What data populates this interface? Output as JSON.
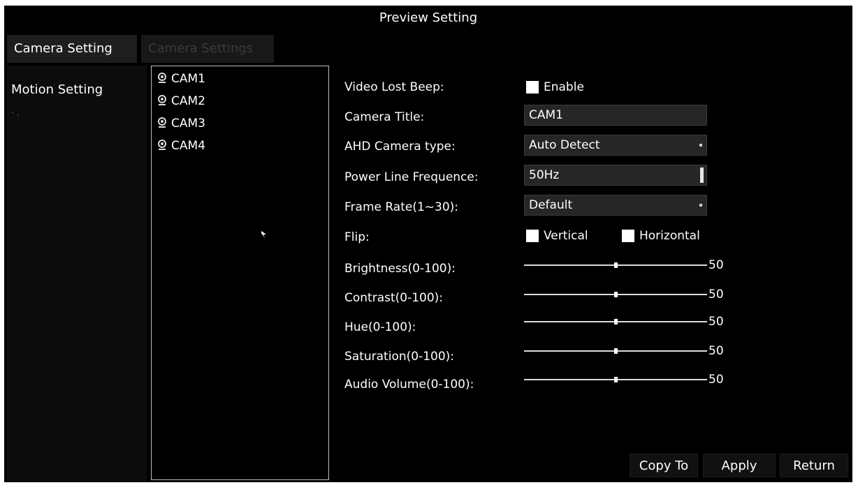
{
  "window": {
    "title": "Preview Setting"
  },
  "tabs": [
    {
      "label": "Camera Setting",
      "active": true
    },
    {
      "label": "Camera Settings",
      "active": false
    }
  ],
  "sidebar": {
    "items": [
      {
        "label": "Motion Setting"
      }
    ]
  },
  "camera_list": {
    "items": [
      {
        "label": "CAM1",
        "icon": "camera-icon"
      },
      {
        "label": "CAM2",
        "icon": "camera-icon"
      },
      {
        "label": "CAM3",
        "icon": "camera-icon"
      },
      {
        "label": "CAM4",
        "icon": "camera-icon"
      }
    ]
  },
  "form": {
    "video_lost_beep": {
      "label": "Video Lost Beep:",
      "option": "Enable",
      "checked": false
    },
    "camera_title": {
      "label": "Camera Title:",
      "value": "CAM1"
    },
    "ahd_camera_type": {
      "label": "AHD Camera type:",
      "value": "Auto Detect"
    },
    "power_line_frequence": {
      "label": "Power Line Frequence:",
      "value": "50Hz"
    },
    "frame_rate": {
      "label": "Frame Rate(1~30):",
      "value": "Default"
    },
    "flip": {
      "label": "Flip:",
      "vertical": {
        "label": "Vertical",
        "checked": false
      },
      "horizontal": {
        "label": "Horizontal",
        "checked": false
      }
    },
    "sliders": [
      {
        "label": "Brightness(0-100):",
        "value": "50",
        "level": 0.5
      },
      {
        "label": "Contrast(0-100):",
        "value": "50",
        "level": 0.5
      },
      {
        "label": "Hue(0-100):",
        "value": "50",
        "level": 0.5
      },
      {
        "label": "Saturation(0-100):",
        "value": "50",
        "level": 0.5
      },
      {
        "label": "Audio Volume(0-100):",
        "value": "50",
        "level": 0.5
      }
    ]
  },
  "buttons": {
    "copy_to": "Copy To",
    "apply": "Apply",
    "return": "Return"
  },
  "colors": {
    "background": "#000000",
    "text": "#ffffff",
    "field": "#262626",
    "border": "#bdbdbd"
  }
}
